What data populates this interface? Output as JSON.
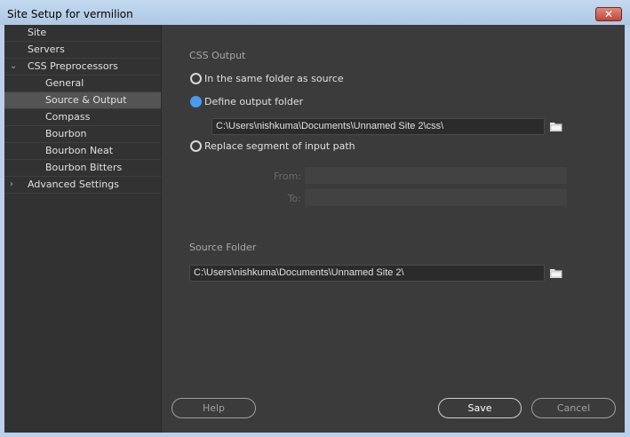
{
  "window": {
    "title": "Site Setup for vermilion",
    "close_label": "✕"
  },
  "sidebar": {
    "items": [
      {
        "label": "Site",
        "level": 1
      },
      {
        "label": "Servers",
        "level": 1
      },
      {
        "label": "CSS Preprocessors",
        "level": 1,
        "chevron": "⌄"
      },
      {
        "label": "General",
        "level": 2
      },
      {
        "label": "Source & Output",
        "level": 2,
        "selected": true
      },
      {
        "label": "Compass",
        "level": 2
      },
      {
        "label": "Bourbon",
        "level": 2
      },
      {
        "label": "Bourbon Neat",
        "level": 2
      },
      {
        "label": "Bourbon Bitters",
        "level": 2
      },
      {
        "label": "Advanced Settings",
        "level": 1,
        "chevron": "›"
      }
    ]
  },
  "css_output": {
    "heading": "CSS Output",
    "option_same": "In the same folder as source",
    "option_define": "Define output folder",
    "output_path": "C:\\Users\\nishkuma\\Documents\\Unnamed Site 2\\css\\",
    "option_replace": "Replace segment of input path",
    "from_label": "From:",
    "from_value": "",
    "to_label": "To:",
    "to_value": "",
    "selected": "define"
  },
  "source_folder": {
    "heading": "Source Folder",
    "path": "C:\\Users\\nishkuma\\Documents\\Unnamed Site 2\\"
  },
  "buttons": {
    "help": "Help",
    "save": "Save",
    "cancel": "Cancel"
  },
  "colors": {
    "accent": "#4a9af0"
  }
}
